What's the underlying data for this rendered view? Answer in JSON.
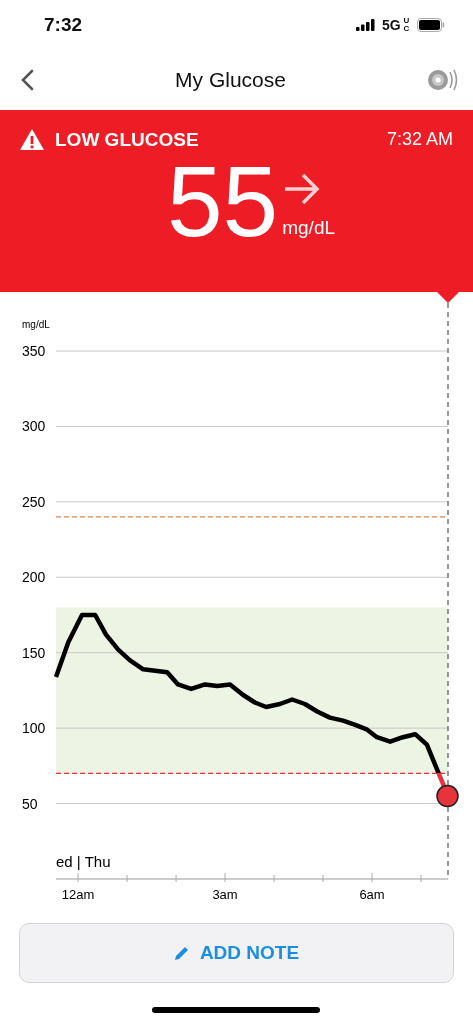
{
  "status_bar": {
    "time": "7:32",
    "network": "5G",
    "network_sub": "UC"
  },
  "nav": {
    "title": "My Glucose"
  },
  "alert": {
    "kind": "low",
    "label": "LOW GLUCOSE",
    "time": "7:32 AM",
    "value": "55",
    "unit": "mg/dL"
  },
  "chart": {
    "day_label": "ed | Thu",
    "midnight_tick_label": "12am",
    "chart_data": {
      "type": "line",
      "ylabel": "mg/dL",
      "grid": true,
      "xlim": [
        -0.45,
        7.55
      ],
      "ylim": [
        0,
        350
      ],
      "x": [
        -0.45,
        -0.2,
        0.08,
        0.35,
        0.57,
        0.82,
        1.06,
        1.33,
        1.82,
        2.04,
        2.31,
        2.59,
        2.84,
        3.1,
        3.37,
        3.61,
        3.84,
        4.12,
        4.37,
        4.63,
        4.88,
        5.14,
        5.41,
        5.67,
        5.9,
        6.1,
        6.37,
        6.63,
        6.88,
        7.12,
        7.31,
        7.55
      ],
      "series": [
        {
          "color": "#000000",
          "values": [
            134,
            157,
            175,
            175,
            162,
            152,
            145,
            139,
            137,
            129,
            126,
            129,
            128,
            129,
            122,
            117,
            114,
            116,
            119,
            116,
            111,
            107,
            105,
            102,
            99,
            94,
            91,
            94,
            96,
            89,
            74,
            55
          ]
        }
      ],
      "yticks": [
        50,
        100,
        150,
        200,
        250,
        300,
        350
      ],
      "xticks": [
        {
          "value": 3,
          "label": "3am"
        },
        {
          "value": 6,
          "label": "6am"
        }
      ],
      "bands": [
        {
          "axis": "y",
          "from": 70,
          "to": 180,
          "color": "#eef4e3"
        }
      ],
      "ref_lines": [
        {
          "axis": "y",
          "value": 240,
          "color": "#e0805a"
        },
        {
          "axis": "y",
          "value": 70,
          "color": "#e8333b"
        }
      ]
    }
  },
  "add_note_button": {
    "label": "ADD NOTE"
  }
}
